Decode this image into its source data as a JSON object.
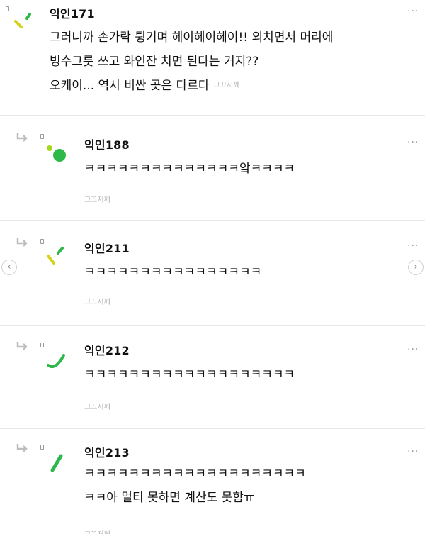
{
  "icons": {
    "more": "more-horizontal-icon",
    "reply": "reply-arrow-icon",
    "prev": "chevron-left-icon",
    "next": "chevron-right-icon"
  },
  "colors": {
    "avatar_yellow": "#d4d21a",
    "avatar_green": "#2db84a",
    "avatar_lime": "#a6d81e"
  },
  "comments": [
    {
      "author": "익인171",
      "lines": [
        "그러니까 손가락 튕기며 헤이헤이헤이!! 외치면서 머리에",
        "빙수그릇 쓰고 와인잔 치면 된다는 거지??",
        "오케이... 역시 비싼 곳은 다르다"
      ],
      "timestamp": "그끄저께",
      "more": "···"
    },
    {
      "author": "익인188",
      "lines": [
        "ㅋㅋㅋㅋㅋㅋㅋㅋㅋㅋㅋㅋㅋㅋ앜ㅋㅋㅋㅋ"
      ],
      "timestamp": "그끄저께",
      "more": "···"
    },
    {
      "author": "익인211",
      "lines": [
        "ㅋㅋㅋㅋㅋㅋㅋㅋㅋㅋㅋㅋㅋㅋㅋㅋ"
      ],
      "timestamp": "그끄저께",
      "more": "···"
    },
    {
      "author": "익인212",
      "lines": [
        "ㅋㅋㅋㅋㅋㅋㅋㅋㅋㅋㅋㅋㅋㅋㅋㅋㅋㅋㅋ"
      ],
      "timestamp": "그끄저께",
      "more": "···"
    },
    {
      "author": "익인213",
      "lines": [
        "ㅋㅋㅋㅋㅋㅋㅋㅋㅋㅋㅋㅋㅋㅋㅋㅋㅋㅋㅋㅋ",
        "ㅋㅋ아 멀티 못하면 계산도 못함ㅠ"
      ],
      "timestamp": "그끄저께",
      "more": "···"
    }
  ],
  "nav": {
    "prev": "‹",
    "next": "›"
  }
}
